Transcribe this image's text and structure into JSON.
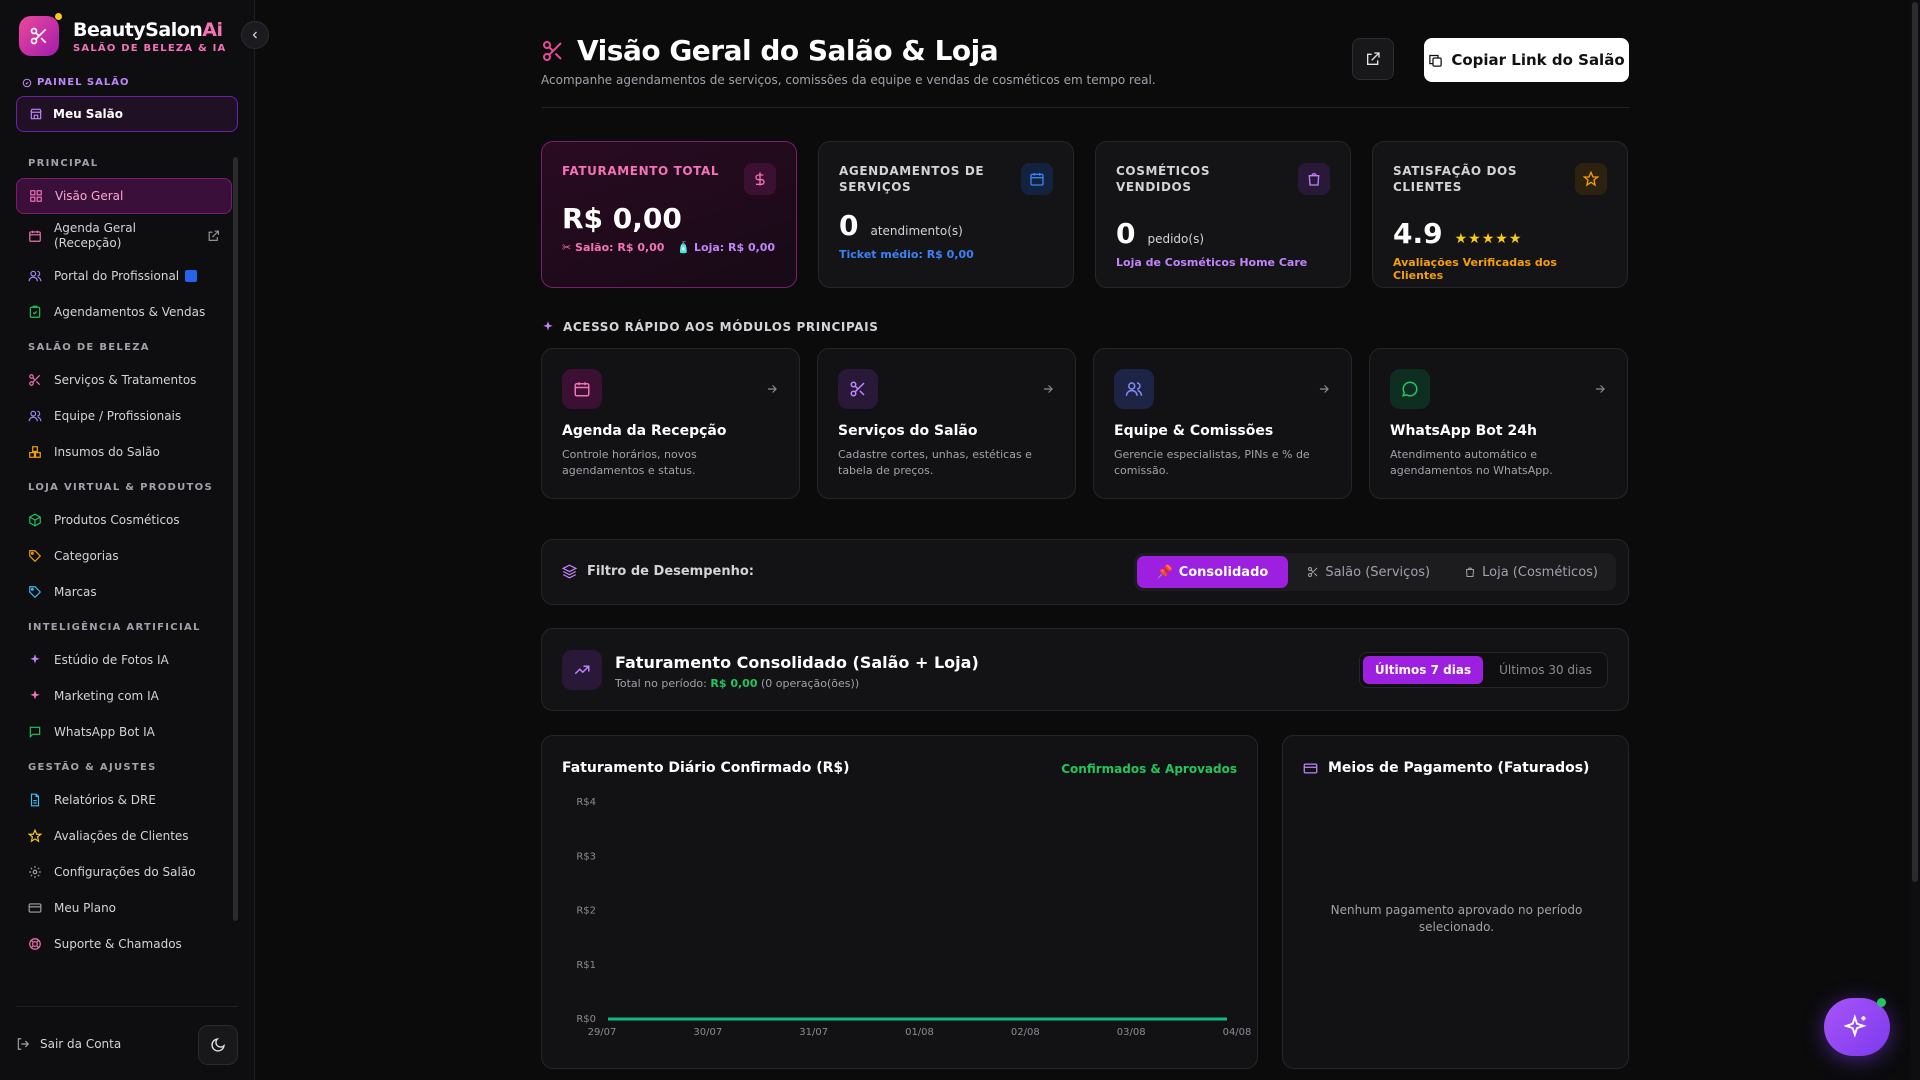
{
  "brand": {
    "name": "BeautySalon",
    "name_suffix": "Ai",
    "tagline": "SALÃO DE BELEZA & IA"
  },
  "panel": {
    "label": "PAINEL SALÃO",
    "button": "Meu Salão"
  },
  "nav": {
    "sections": [
      {
        "title": "PRINCIPAL",
        "items": [
          "Visão Geral",
          "Agenda Geral (Recepção)",
          "Portal do Profissional",
          "Agendamentos & Vendas"
        ]
      },
      {
        "title": "SALÃO DE BELEZA",
        "items": [
          "Serviços & Tratamentos",
          "Equipe / Profissionais",
          "Insumos do Salão"
        ]
      },
      {
        "title": "LOJA VIRTUAL & PRODUTOS",
        "items": [
          "Produtos Cosméticos",
          "Categorias",
          "Marcas"
        ]
      },
      {
        "title": "INTELIGÊNCIA ARTIFICIAL",
        "items": [
          "Estúdio de Fotos IA",
          "Marketing com IA",
          "WhatsApp Bot IA"
        ]
      },
      {
        "title": "GESTÃO & AJUSTES",
        "items": [
          "Relatórios & DRE",
          "Avaliações de Clientes",
          "Configurações do Salão",
          "Meu Plano",
          "Suporte & Chamados"
        ]
      }
    ],
    "logout": "Sair da Conta"
  },
  "header": {
    "title": "Visão Geral do Salão & Loja",
    "subtitle": "Acompanhe agendamentos de serviços, comissões da equipe e vendas de cosméticos em tempo real.",
    "copy_button": "Copiar Link do Salão"
  },
  "kpis": {
    "revenue": {
      "title": "FATURAMENTO TOTAL",
      "value": "R$ 0,00",
      "salon": "Salão: R$ 0,00",
      "store": "Loja: R$ 0,00"
    },
    "appointments": {
      "title": "AGENDAMENTOS DE SERVIÇOS",
      "value": "0",
      "unit": "atendimento(s)",
      "foot": "Ticket médio: R$ 0,00"
    },
    "cosmetics": {
      "title": "COSMÉTICOS VENDIDOS",
      "value": "0",
      "unit": "pedido(s)",
      "foot": "Loja de Cosméticos Home Care"
    },
    "satisfaction": {
      "title": "SATISFAÇÃO DOS CLIENTES",
      "value": "4.9",
      "stars": "★★★★★",
      "foot": "Avaliações Verificadas dos Clientes"
    }
  },
  "quick_access": {
    "label": "ACESSO RÁPIDO AOS MÓDULOS PRINCIPAIS",
    "cards": [
      {
        "title": "Agenda da Recepção",
        "desc": "Controle horários, novos agendamentos e status."
      },
      {
        "title": "Serviços do Salão",
        "desc": "Cadastre cortes, unhas, estéticas e tabela de preços."
      },
      {
        "title": "Equipe & Comissões",
        "desc": "Gerencie especialistas, PINs e % de comissão."
      },
      {
        "title": "WhatsApp Bot 24h",
        "desc": "Atendimento automático e agendamentos no WhatsApp."
      }
    ]
  },
  "filter": {
    "label": "Filtro de Desempenho:",
    "options": [
      "Consolidado",
      "Salão (Serviços)",
      "Loja (Cosméticos)"
    ],
    "selected": "Consolidado"
  },
  "revenue_panel": {
    "title": "Faturamento Consolidado (Salão + Loja)",
    "sub_prefix": "Total no período:",
    "sub_value": "R$ 0,00",
    "sub_suffix": "(0 operação(ões))",
    "periods": [
      "Últimos 7 dias",
      "Últimos 30 dias"
    ],
    "selected_period": "Últimos 7 dias"
  },
  "chart_data": {
    "type": "line",
    "title": "Faturamento Diário Confirmado (R$)",
    "badge": "Confirmados & Aprovados",
    "x": [
      "29/07",
      "30/07",
      "31/07",
      "01/08",
      "02/08",
      "03/08",
      "04/08"
    ],
    "series": [
      {
        "values": [
          0,
          0,
          0,
          0,
          0,
          0,
          0
        ],
        "color": "#10b981"
      }
    ],
    "yticks": [
      "R$0",
      "R$1",
      "R$2",
      "R$3",
      "R$4"
    ],
    "ylim": [
      0,
      4
    ]
  },
  "payments": {
    "title": "Meios de Pagamento (Faturados)",
    "empty": "Nenhum pagamento aprovado no período selecionado."
  },
  "colors": {
    "accent": "#9d1fe0",
    "pink": "#f472b6",
    "green": "#22c55e",
    "blue": "#3b82f6",
    "orange": "#f59e0b"
  }
}
